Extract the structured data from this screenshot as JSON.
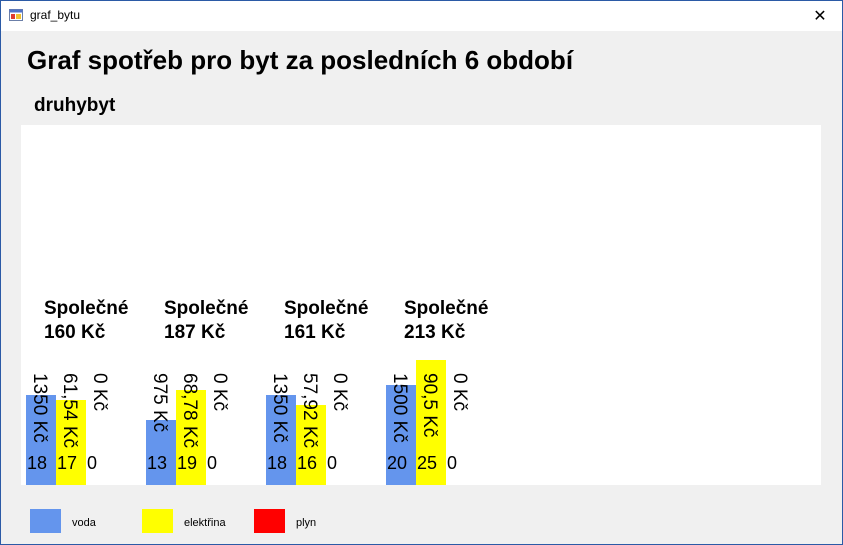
{
  "window": {
    "title": "graf_bytu",
    "close_glyph": "✕"
  },
  "header": {
    "title": "Graf spotřeb pro byt za posledních 6 období",
    "subtitle": "druhybyt"
  },
  "colors": {
    "voda": "#6495ed",
    "elektrina": "#ffff00",
    "plyn": "#ff0000"
  },
  "chart_data": {
    "type": "bar",
    "series": [
      {
        "name": "voda",
        "color": "#6495ed"
      },
      {
        "name": "elektřina",
        "color": "#ffff00"
      },
      {
        "name": "plyn",
        "color": "#ff0000"
      }
    ],
    "groups": [
      {
        "common_label": "Společné",
        "common_cost": "160 Kč",
        "bars": [
          {
            "value": 18,
            "cost": "1350 Kč"
          },
          {
            "value": 17,
            "cost": "61,54 Kč"
          },
          {
            "value": 0,
            "cost": "0 Kč"
          }
        ]
      },
      {
        "common_label": "Společné",
        "common_cost": "187 Kč",
        "bars": [
          {
            "value": 13,
            "cost": "975 Kč"
          },
          {
            "value": 19,
            "cost": "68,78 Kč"
          },
          {
            "value": 0,
            "cost": "0 Kč"
          }
        ]
      },
      {
        "common_label": "Společné",
        "common_cost": "161 Kč",
        "bars": [
          {
            "value": 18,
            "cost": "1350 Kč"
          },
          {
            "value": 16,
            "cost": "57,92 Kč"
          },
          {
            "value": 0,
            "cost": "0 Kč"
          }
        ]
      },
      {
        "common_label": "Společné",
        "common_cost": "213 Kč",
        "bars": [
          {
            "value": 20,
            "cost": "1500 Kč"
          },
          {
            "value": 25,
            "cost": "90,5 Kč"
          },
          {
            "value": 0,
            "cost": "0 Kč"
          }
        ]
      }
    ]
  },
  "legend": {
    "items": [
      {
        "label": "voda",
        "color": "#6495ed"
      },
      {
        "label": "elektřina",
        "color": "#ffff00"
      },
      {
        "label": "plyn",
        "color": "#ff0000"
      }
    ]
  }
}
